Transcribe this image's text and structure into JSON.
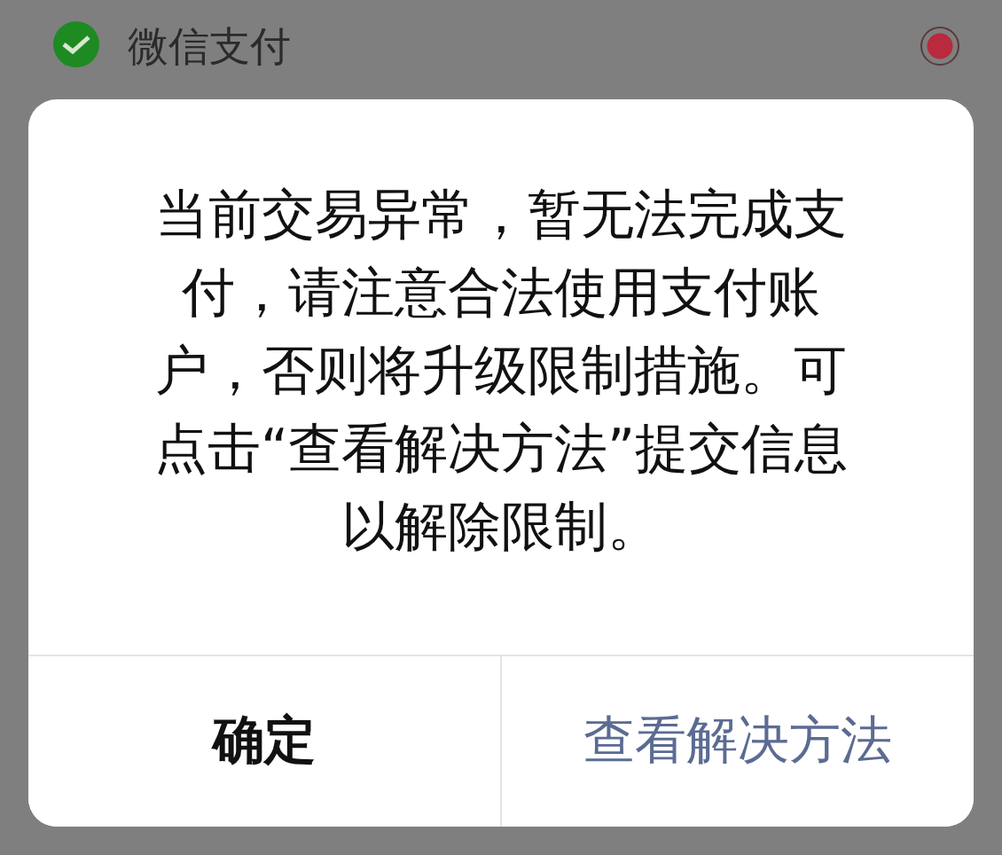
{
  "payment_method": {
    "label": "微信支付",
    "selected": true
  },
  "dialog": {
    "message": "当前交易异常，暂无法完成支付，请注意合法使用支付账户，否则将升级限制措施。可点击“查看解决方法”提交信息以解除限制。",
    "buttons": [
      {
        "label": "确定",
        "kind": "default"
      },
      {
        "label": "查看解决方法",
        "kind": "primary"
      }
    ]
  }
}
